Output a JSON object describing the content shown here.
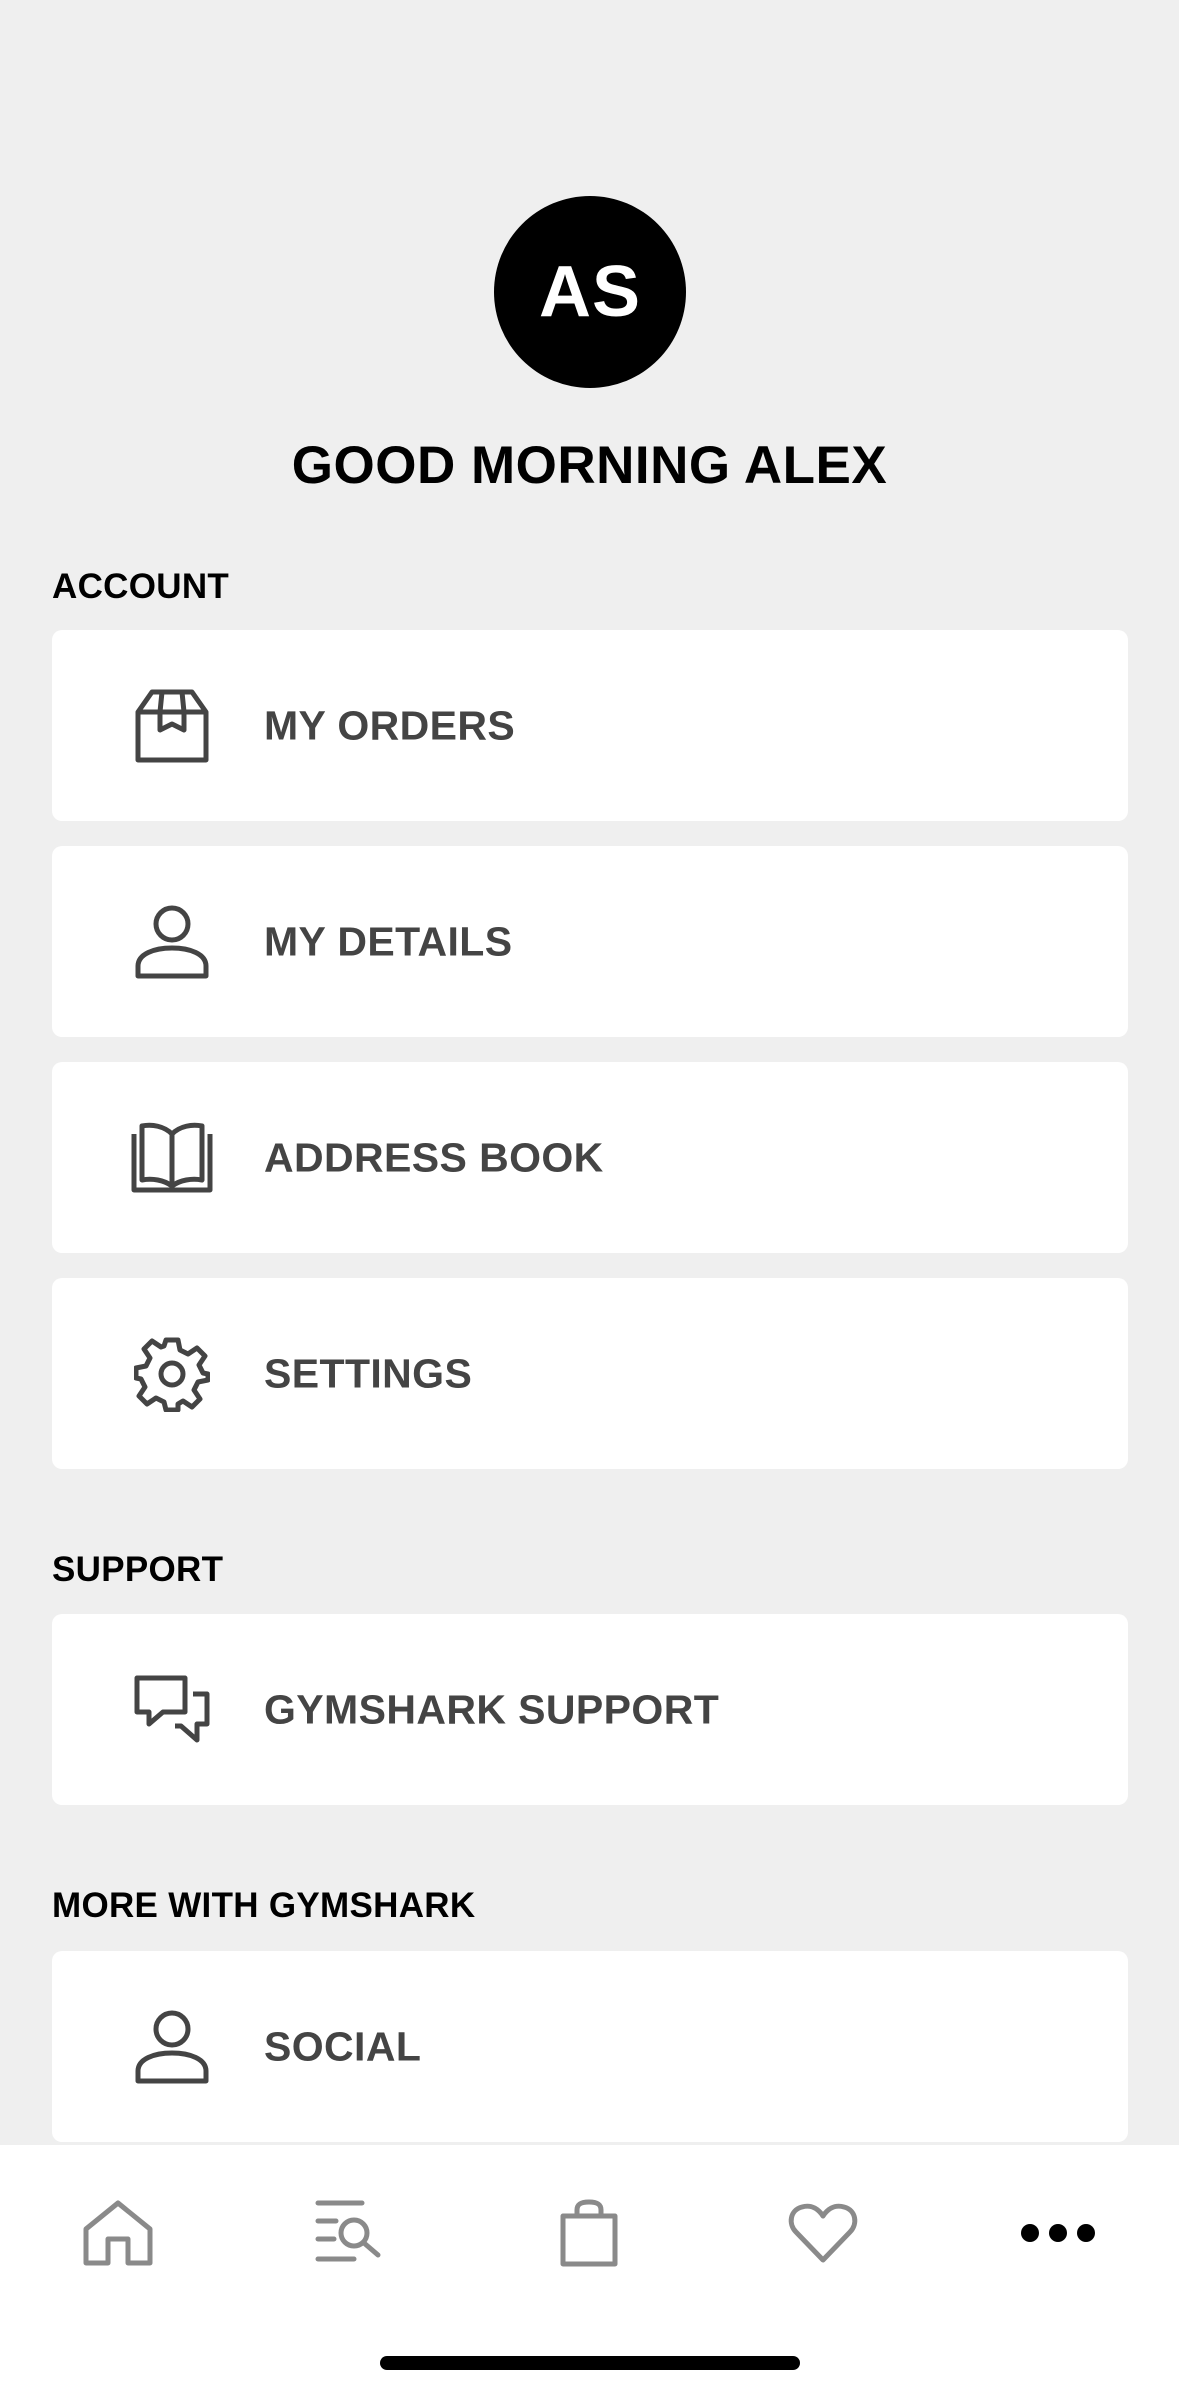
{
  "profile": {
    "initials": "AS",
    "greeting": "GOOD MORNING ALEX"
  },
  "sections": {
    "account": {
      "title": "ACCOUNT",
      "items": [
        {
          "label": "MY ORDERS",
          "icon": "package-icon"
        },
        {
          "label": "MY DETAILS",
          "icon": "person-icon"
        },
        {
          "label": "ADDRESS BOOK",
          "icon": "book-icon"
        },
        {
          "label": "SETTINGS",
          "icon": "gear-icon"
        }
      ]
    },
    "support": {
      "title": "SUPPORT",
      "items": [
        {
          "label": "GYMSHARK SUPPORT",
          "icon": "chat-bubbles-icon"
        }
      ]
    },
    "more": {
      "title": "MORE WITH GYMSHARK",
      "items": [
        {
          "label": "SOCIAL",
          "icon": "person-icon"
        }
      ]
    }
  },
  "tabbar": {
    "items": [
      {
        "icon": "home-icon",
        "active": false
      },
      {
        "icon": "search-list-icon",
        "active": false
      },
      {
        "icon": "shopping-bag-icon",
        "active": false
      },
      {
        "icon": "heart-icon",
        "active": false
      },
      {
        "icon": "more-dots-icon",
        "active": true
      }
    ]
  },
  "colors": {
    "background": "#efefef",
    "card": "#ffffff",
    "text_primary": "#000000",
    "text_label": "#444444",
    "icon": "#444444",
    "tab_inactive": "#8a8a8a"
  }
}
